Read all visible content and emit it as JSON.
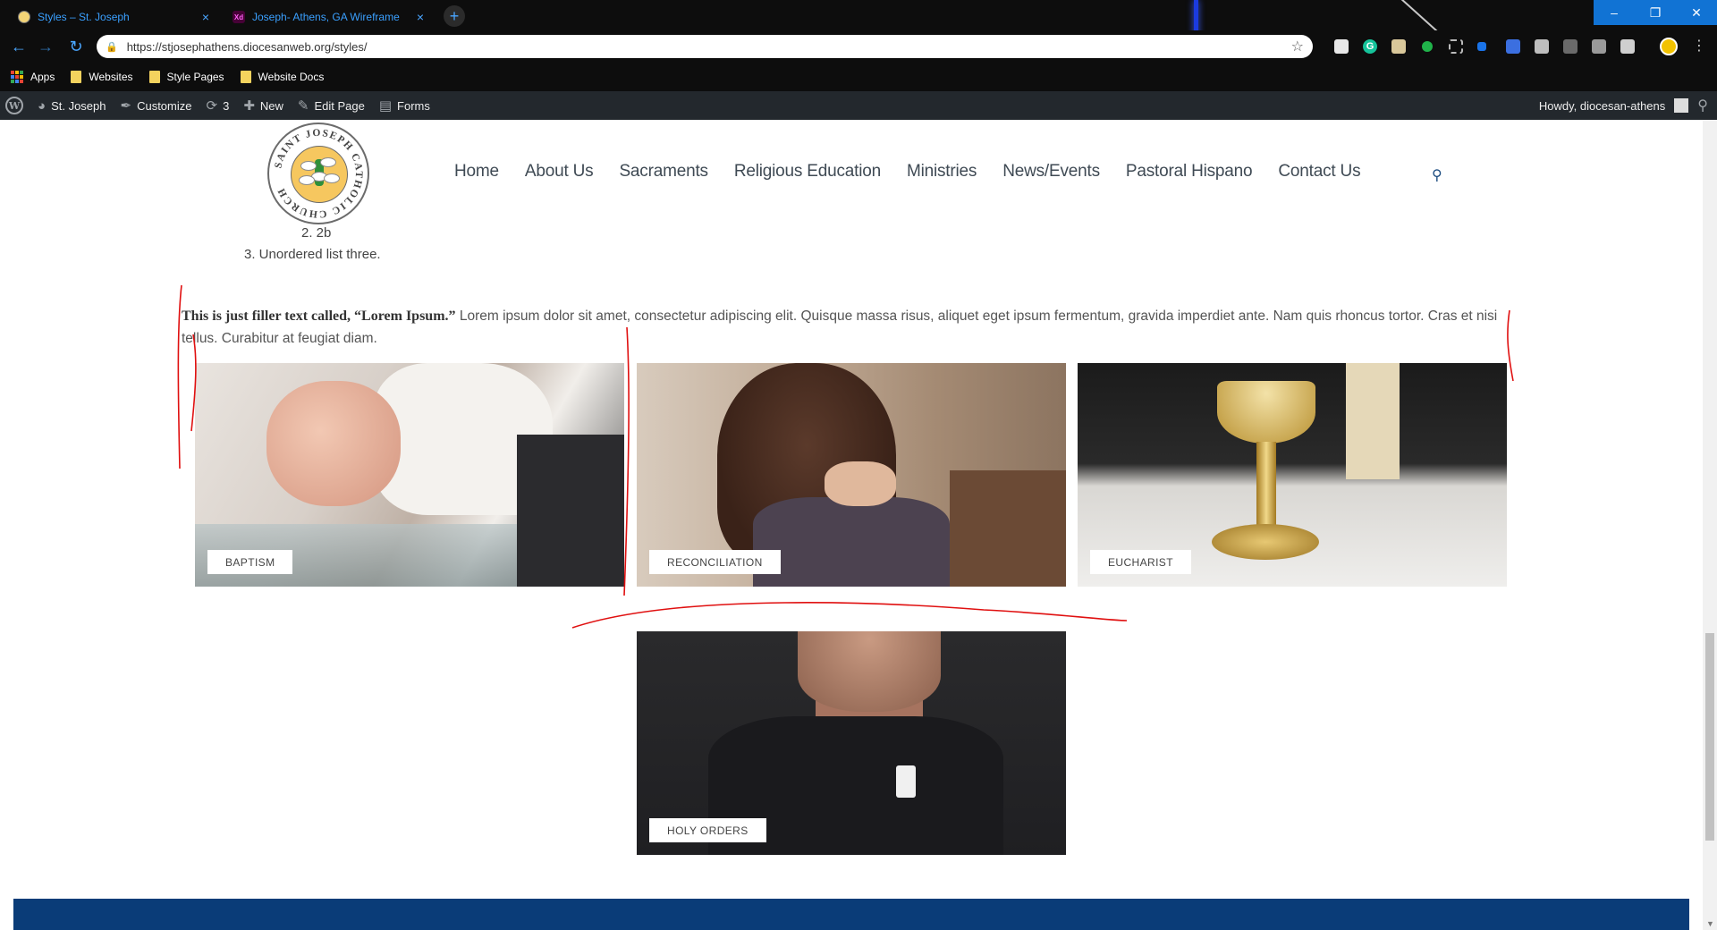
{
  "browser": {
    "tabs": [
      {
        "label": "Styles – St. Joseph",
        "close": "×"
      },
      {
        "label": "Joseph- Athens, GA Wireframe",
        "favicon_text": "Xd",
        "close": "×"
      }
    ],
    "new_tab": "+",
    "url": "https://stjosephathens.diocesanweb.org/styles/",
    "bookmarks": [
      "Apps",
      "Websites",
      "Style Pages",
      "Website Docs"
    ],
    "extension_g_label": "G"
  },
  "wp_admin_bar": {
    "site_name": "St. Joseph",
    "customize": "Customize",
    "updates_count": "3",
    "new": "New",
    "edit_page": "Edit Page",
    "forms": "Forms",
    "howdy": "Howdy, diocesan-athens"
  },
  "site": {
    "logo_text": "SAINT JOSEPH CATHOLIC CHURCH",
    "nav": [
      "Home",
      "About Us",
      "Sacraments",
      "Religious Education",
      "Ministries",
      "News/Events",
      "Pastoral Hispano",
      "Contact Us"
    ]
  },
  "content": {
    "list_item_2b": "2. 2b",
    "list_item_3": "3. Unordered list three.",
    "filler_bold": "This is just filler text called, “Lorem Ipsum.”",
    "filler_body": " Lorem ipsum dolor sit amet, consectetur adipiscing elit. Quisque massa risus, aliquet eget ipsum fermentum, gravida imperdiet ante. Nam quis rhoncus tortor. Cras et nisi tellus. Curabitur at feugiat diam."
  },
  "cards": [
    {
      "label": "BAPTISM"
    },
    {
      "label": "RECONCILIATION"
    },
    {
      "label": "EUCHARIST"
    },
    {
      "label": "HOLY ORDERS"
    }
  ],
  "colors": {
    "nav_text": "#3f4a54",
    "footer_navy": "#0a3c78",
    "annotation_red": "#e01010",
    "logo_gold": "#f6c75f"
  }
}
